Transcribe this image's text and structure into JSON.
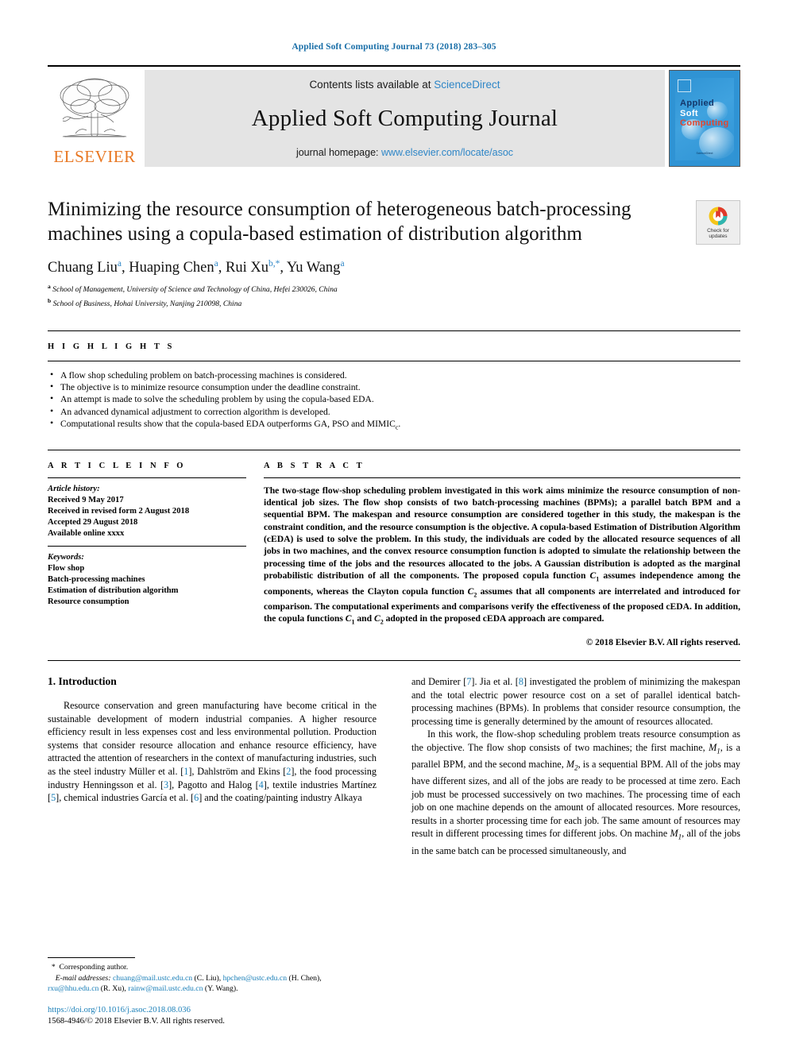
{
  "running_head": "Applied Soft Computing Journal 73 (2018) 283–305",
  "masthead": {
    "publisher_name": "ELSEVIER",
    "contents_prefix": "Contents lists available at ",
    "contents_link": "ScienceDirect",
    "journal_name": "Applied Soft Computing Journal",
    "homepage_prefix": "journal homepage: ",
    "homepage_link": "www.elsevier.com/locate/asoc",
    "cover": {
      "line1": "Applied",
      "line2": "Soft",
      "line3": "Computing",
      "footer": "ScienceDirect"
    }
  },
  "crossmark": {
    "line1": "Check for",
    "line2": "updates"
  },
  "article": {
    "title": "Minimizing the resource consumption of heterogeneous batch-processing machines using a copula-based estimation of distribution algorithm",
    "authors_html": "Chuang Liu<sup class=\"aff-mark\">a</sup>, Huaping Chen<sup class=\"aff-mark\">a</sup>, Rui Xu<sup class=\"aff-mark\">b,*</sup>, Yu Wang<sup class=\"aff-mark\">a</sup>",
    "affiliations": [
      {
        "mark": "a",
        "text": "School of Management, University of Science and Technology of China, Hefei  230026, China"
      },
      {
        "mark": "b",
        "text": "School of Business, Hohai University, Nanjing  210098, China"
      }
    ]
  },
  "highlights": {
    "label": "H I G H L I G H T S",
    "items_html": [
      "A flow shop scheduling problem on batch-processing machines is considered.",
      "The objective is to minimize resource consumption under the deadline constraint.",
      "An attempt is made to solve the scheduling problem by using the copula-based EDA.",
      "An advanced dynamical adjustment to correction algorithm is developed.",
      "Computational results show that the copula-based EDA outperforms GA, PSO and MIMIC<sub class=\"sub\">c</sub>."
    ]
  },
  "article_info": {
    "label": "A R T I C L E   I N F O",
    "history_title": "Article history:",
    "history": [
      "Received 9 May 2017",
      "Received in revised form 2 August 2018",
      "Accepted 29 August 2018",
      "Available online xxxx"
    ],
    "keywords_title": "Keywords:",
    "keywords": [
      "Flow shop",
      "Batch-processing machines",
      "Estimation of distribution algorithm",
      "Resource consumption"
    ]
  },
  "abstract": {
    "label": "A B S T R A C T",
    "text_html": "The two-stage flow-shop scheduling problem investigated in this work aims minimize the resource consumption of non-identical job sizes. The flow shop consists of two batch-processing machines (BPMs); a parallel batch BPM and a sequential BPM. The makespan and resource consumption are considered together in this study, the makespan is the constraint condition, and the resource consumption is the objective. A copula-based Estimation of Distribution Algorithm (cEDA) is used to solve the problem. In this study, the individuals are coded by the allocated resource sequences of all jobs in two machines, and the convex resource consumption function is adopted to simulate the relationship between the processing time of the jobs and the resources allocated to the jobs. A Gaussian distribution is adopted as the marginal probabilistic distribution of all the components. The proposed copula function <span class=\"ital\">C</span><sub class=\"sub\">1</sub> assumes independence among the components, whereas the Clayton copula function <span class=\"ital\">C</span><sub class=\"sub\">2</sub> assumes that all components are interrelated and introduced for comparison. The computational experiments and comparisons verify the effectiveness of the proposed cEDA. In addition, the copula functions <span class=\"ital\">C</span><sub class=\"sub\">1</sub> and <span class=\"ital\">C</span><sub class=\"sub\">2</sub> adopted in the proposed cEDA approach are compared.",
    "copyright": "© 2018 Elsevier B.V. All rights reserved."
  },
  "body": {
    "section_heading": "1. Introduction",
    "left_paragraphs_html": [
      "Resource conservation and green manufacturing have become critical in the sustainable development of modern industrial companies. A higher resource efficiency result in less expenses cost and less environmental pollution. Production systems that consider resource allocation and enhance resource efficiency, have attracted the attention of researchers in the context of manufacturing industries, such as the steel industry Müller et al. [<span class=\"ref\">1</span>], Dahlström and Ekins [<span class=\"ref\">2</span>], the food processing industry Henningsson et al. [<span class=\"ref\">3</span>], Pagotto and Halog [<span class=\"ref\">4</span>], textile industries Martínez [<span class=\"ref\">5</span>], chemical industries García et al. [<span class=\"ref\">6</span>] and the coating/painting industry Alkaya"
    ],
    "right_paragraphs_html": [
      "and Demirer [<span class=\"ref\">7</span>]. Jia et al. [<span class=\"ref\">8</span>] investigated the problem of minimizing the makespan and the total electric power resource cost on a set of parallel identical batch-processing machines (BPMs). In problems that consider resource consumption, the processing time is generally determined by the amount of resources allocated.",
      "In this work, the flow-shop scheduling problem treats resource consumption as the objective. The flow shop consists of two machines; the first machine, <span class=\"mvar\">M</span><sub class=\"msub\">1</sub>, is a parallel BPM, and the second machine, <span class=\"mvar\">M</span><sub class=\"msub\">2</sub>, is a sequential BPM. All of the jobs may have different sizes, and all of the jobs are ready to be processed at time zero. Each job must be processed successively on two machines. The processing time of each job on one machine depends on the amount of allocated resources. More resources, results in a shorter processing time for each job. The same amount of resources may result in different processing times for different jobs. On machine <span class=\"mvar\">M</span><sub class=\"msub\">1</sub>, all of the jobs in the same batch can be processed simultaneously, and"
    ]
  },
  "footnotes": {
    "corresponding": "Corresponding author.",
    "email_label": "E-mail addresses:",
    "emails_html": "<span class=\"lnk\">chuang@mail.ustc.edu.cn</span> (C. Liu), <span class=\"lnk\">hpchen@ustc.edu.cn</span> (H. Chen), <span class=\"lnk\">rxu@hhu.edu.cn</span> (R. Xu), <span class=\"lnk\">rainw@mail.ustc.edu.cn</span> (Y. Wang).",
    "doi": "https://doi.org/10.1016/j.asoc.2018.08.036",
    "issn_line": "1568-4946/© 2018 Elsevier B.V. All rights reserved."
  },
  "colors": {
    "link_blue": "#2e86c7",
    "ref_blue": "#1a7fb8",
    "elsevier_orange": "#e87722",
    "cover_blue": "#2f93d4"
  }
}
